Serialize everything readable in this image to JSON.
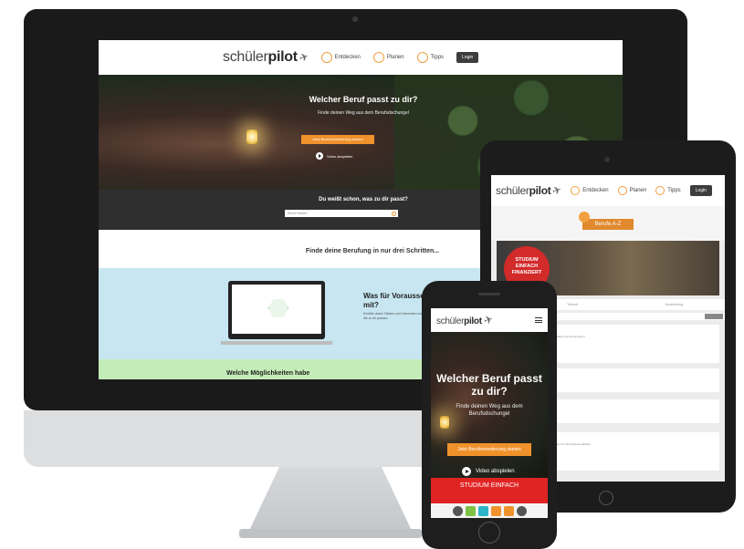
{
  "brand": {
    "logo_main": "schüler",
    "logo_bold": "pilot"
  },
  "colors": {
    "accent": "#f0922c",
    "red": "#e02424",
    "dark": "#2f2f2f",
    "blue_band": "#c7e6f1",
    "green_band": "#c4ecb8"
  },
  "desktop": {
    "nav": {
      "items": [
        {
          "label": "Entdecken",
          "icon": "binoculars-icon"
        },
        {
          "label": "Planen",
          "icon": "compass-icon"
        },
        {
          "label": "Tipps",
          "icon": "lightbulb-icon"
        }
      ],
      "login": "Login"
    },
    "hero": {
      "title": "Welcher Beruf passt zu dir?",
      "subtitle": "Finde deinen Weg aus dem Berufsdschungel",
      "cta": "Jetzt Berufsorientierung starten",
      "video": "Video abspielen"
    },
    "search": {
      "label": "Du weißt schon, was zu dir passt?",
      "placeholder": "Beruf finden"
    },
    "steps_title": "Finde deine Berufung in nur drei Schritten...",
    "step1": {
      "heading": "Was für Voraussetzungen bringe ich mit?",
      "text": "Ermittle deine Stärken und Interessen und finde Berufe, die zu dir passen."
    },
    "step2": {
      "heading": "Welche Möglichkeiten habe"
    }
  },
  "tablet": {
    "nav": {
      "items": [
        "Entdecken",
        "Planen",
        "Tipps"
      ],
      "login": "Login"
    },
    "tag": "Berufe A-Z",
    "badge": "STUDIUM EINFACH FINANZIERT",
    "tabs": [
      "",
      "Teilzeit",
      "Ausbildung"
    ],
    "search_button": "Suchen",
    "cards": [
      {
        "title": "Ingenieurwesen",
        "body": "Ein Beruf mit Zukunft: Ingenieure planen, entwickeln und konstruieren."
      },
      {
        "title": "Technik",
        "body": ""
      },
      {
        "title": "Wissenschaften",
        "body": ""
      },
      {
        "title": "Kaufberufe",
        "body": "Kaufleute arbeiten in vielen Branchen und sorgen für reibungslose Abläufe."
      }
    ]
  },
  "phone": {
    "hero": {
      "title": "Welcher Beruf passt zu dir?",
      "subtitle": "Finde deinen Weg aus dem Berufsdschungel",
      "cta": "Jetzt Berufsorientierung starten",
      "video": "Video abspielen"
    },
    "banner": "STUDIUM EINFACH",
    "bottom_icons": [
      {
        "icon": "user-icon",
        "color": "#555555"
      },
      {
        "icon": "compass-icon",
        "color": "#7dc242"
      },
      {
        "icon": "calculator-icon",
        "color": "#2bb5c8"
      },
      {
        "icon": "search-icon",
        "color": "#f0922c"
      },
      {
        "icon": "bookmark-icon",
        "color": "#f0922c"
      },
      {
        "icon": "clock-icon",
        "color": "#555555"
      }
    ]
  }
}
